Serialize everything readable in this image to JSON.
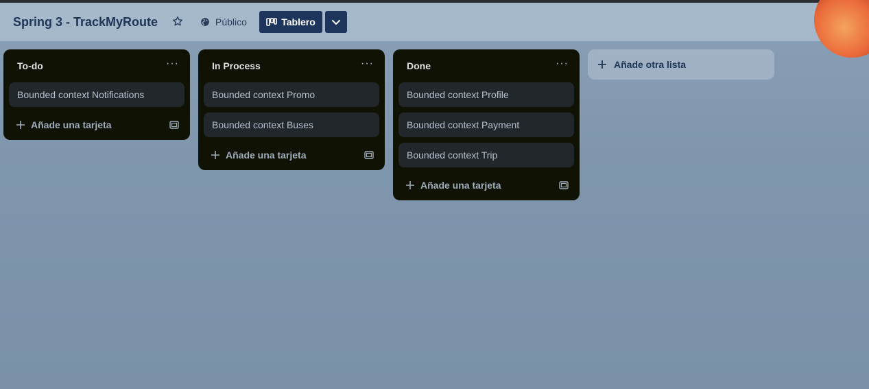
{
  "header": {
    "board_title": "Spring 3 - TrackMyRoute",
    "visibility_label": "Público",
    "view_button_label": "Tablero"
  },
  "lists": [
    {
      "title": "To-do",
      "menu": "···",
      "cards": [
        "Bounded context Notifications"
      ],
      "add_card_label": "Añade una tarjeta"
    },
    {
      "title": "In Process",
      "menu": "···",
      "cards": [
        "Bounded context Promo",
        "Bounded context Buses"
      ],
      "add_card_label": "Añade una tarjeta"
    },
    {
      "title": "Done",
      "menu": "···",
      "cards": [
        "Bounded context Profile",
        "Bounded context Payment",
        "Bounded context Trip"
      ],
      "add_card_label": "Añade una tarjeta"
    }
  ],
  "add_list_label": "Añade otra lista",
  "icons": {
    "star": "star-icon",
    "visibility": "globe-icon",
    "view": "board-icon",
    "dropdown": "chevron-down-icon",
    "add": "plus-icon",
    "template": "card-template-icon",
    "menu": "more-icon"
  },
  "colors": {
    "list_bg": "#101204",
    "card_bg": "#22272b",
    "header_btn": "#1d355c",
    "board_bg": "#7f96ad"
  }
}
